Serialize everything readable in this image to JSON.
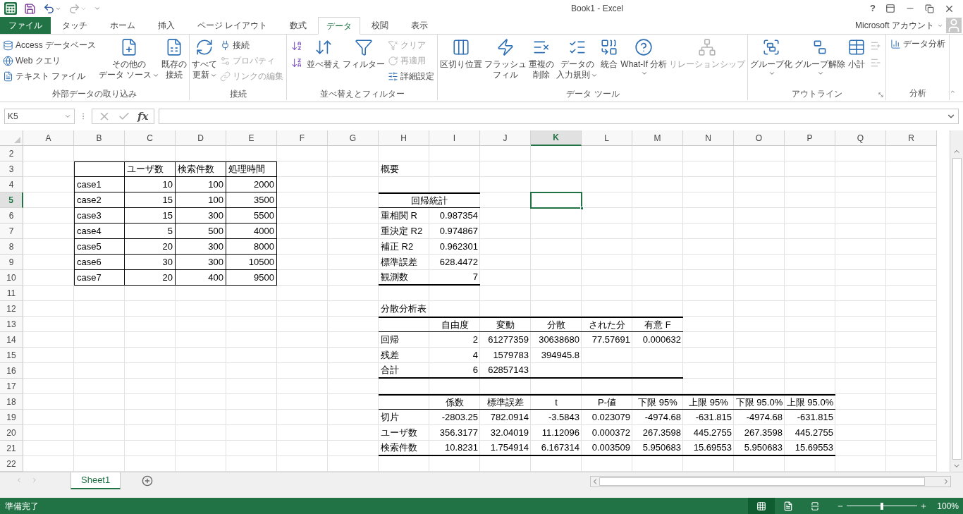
{
  "title_bar": {
    "title": "Book1 - Excel",
    "help": "?",
    "account": "Microsoft アカウント"
  },
  "ribbon_tabs": [
    {
      "label": "ファイル",
      "kind": "file",
      "selected": false
    },
    {
      "label": "タッチ",
      "kind": "tab",
      "selected": false
    },
    {
      "label": "ホーム",
      "kind": "tab",
      "selected": false
    },
    {
      "label": "挿入",
      "kind": "tab",
      "selected": false
    },
    {
      "label": "ページ レイアウト",
      "kind": "tab",
      "selected": false
    },
    {
      "label": "数式",
      "kind": "tab",
      "selected": false
    },
    {
      "label": "データ",
      "kind": "tab",
      "selected": true
    },
    {
      "label": "校閲",
      "kind": "tab",
      "selected": false
    },
    {
      "label": "表示",
      "kind": "tab",
      "selected": false
    }
  ],
  "ribbon_groups": [
    {
      "label": "外部データの取り込み",
      "columns": [
        [
          {
            "kind": "small",
            "label": "Access データベース",
            "disabled": false
          },
          {
            "kind": "small",
            "label": "Web クエリ",
            "disabled": false
          },
          {
            "kind": "small",
            "label": "テキスト ファイル",
            "disabled": false
          }
        ],
        [
          {
            "kind": "large",
            "lines": [
              "その他の",
              "データ ソース"
            ],
            "dropdown": true,
            "disabled": false
          }
        ],
        [
          {
            "kind": "large",
            "lines": [
              "既存の",
              "接続"
            ],
            "disabled": false
          }
        ]
      ]
    },
    {
      "label": "接続",
      "columns": [
        [
          {
            "kind": "large",
            "lines": [
              "すべて",
              "更新"
            ],
            "dropdown": true,
            "disabled": false
          }
        ],
        [
          {
            "kind": "small",
            "label": "接続",
            "disabled": false
          },
          {
            "kind": "small",
            "label": "プロパティ",
            "disabled": true
          },
          {
            "kind": "small",
            "label": "リンクの編集",
            "disabled": true
          }
        ]
      ]
    },
    {
      "label": "並べ替えとフィルター",
      "columns": [
        [
          {
            "kind": "icon",
            "disabled": false
          },
          {
            "kind": "icon",
            "disabled": false
          }
        ],
        [
          {
            "kind": "large",
            "lines": [
              "並べ替え"
            ],
            "disabled": false
          }
        ],
        [
          {
            "kind": "large",
            "lines": [
              "フィルター"
            ],
            "disabled": false
          }
        ],
        [
          {
            "kind": "small",
            "label": "クリア",
            "disabled": true
          },
          {
            "kind": "small",
            "label": "再適用",
            "disabled": true
          },
          {
            "kind": "small",
            "label": "詳細設定",
            "disabled": false
          }
        ]
      ]
    },
    {
      "label": "データ ツール",
      "columns": [
        [
          {
            "kind": "large",
            "lines": [
              "区切り位置"
            ],
            "disabled": false
          }
        ],
        [
          {
            "kind": "large",
            "lines": [
              "フラッシュ",
              "フィル"
            ],
            "disabled": false
          }
        ],
        [
          {
            "kind": "large",
            "lines": [
              "重複の",
              "削除"
            ],
            "disabled": false
          }
        ],
        [
          {
            "kind": "large",
            "lines": [
              "データの",
              "入力規則"
            ],
            "dropdown": true,
            "disabled": false
          }
        ],
        [
          {
            "kind": "large",
            "lines": [
              "統合"
            ],
            "disabled": false
          }
        ],
        [
          {
            "kind": "large",
            "lines": [
              "What-If 分析"
            ],
            "dropdown": true,
            "disabled": false
          }
        ],
        [
          {
            "kind": "large",
            "lines": [
              "リレーションシップ"
            ],
            "disabled": true
          }
        ]
      ]
    },
    {
      "label": "アウトライン",
      "launcher": true,
      "columns": [
        [
          {
            "kind": "large",
            "lines": [
              "グループ化"
            ],
            "dropdown": true,
            "disabled": false
          }
        ],
        [
          {
            "kind": "large",
            "lines": [
              "グループ解除"
            ],
            "dropdown": true,
            "disabled": false
          }
        ],
        [
          {
            "kind": "large",
            "lines": [
              "小計"
            ],
            "disabled": false
          }
        ],
        [
          {
            "kind": "icon",
            "disabled": true
          },
          {
            "kind": "icon",
            "disabled": true
          }
        ]
      ]
    },
    {
      "label": "分析",
      "columns": [
        [
          {
            "kind": "small",
            "label": "データ分析",
            "disabled": false
          }
        ]
      ]
    }
  ],
  "formula_bar": {
    "name_box": "K5",
    "function_label": "fx"
  },
  "grid": {
    "columns": [
      {
        "label": "A",
        "selected": false
      },
      {
        "label": "B",
        "selected": false
      },
      {
        "label": "C",
        "selected": false
      },
      {
        "label": "D",
        "selected": false
      },
      {
        "label": "E",
        "selected": false
      },
      {
        "label": "F",
        "selected": false
      },
      {
        "label": "G",
        "selected": false
      },
      {
        "label": "H",
        "selected": false
      },
      {
        "label": "I",
        "selected": false
      },
      {
        "label": "J",
        "selected": false
      },
      {
        "label": "K",
        "selected": true
      },
      {
        "label": "L",
        "selected": false
      },
      {
        "label": "M",
        "selected": false
      },
      {
        "label": "N",
        "selected": false
      },
      {
        "label": "O",
        "selected": false
      },
      {
        "label": "P",
        "selected": false
      },
      {
        "label": "Q",
        "selected": false
      },
      {
        "label": "R",
        "selected": false
      }
    ],
    "rows": [
      {
        "header": "2",
        "selected": false
      },
      {
        "header": "3",
        "selected": false,
        "cells": [
          null,
          null,
          {
            "text": "ユーザ数",
            "kind": "text"
          },
          {
            "text": "検索件数",
            "kind": "text"
          },
          {
            "text": "処理時間",
            "kind": "text"
          },
          null,
          null,
          {
            "text": "概要",
            "kind": "text"
          }
        ]
      },
      {
        "header": "4",
        "selected": false,
        "cells": [
          null,
          {
            "text": "case1",
            "kind": "text"
          },
          {
            "text": "10",
            "kind": "num"
          },
          {
            "text": "100",
            "kind": "num"
          },
          {
            "text": "2000",
            "kind": "num"
          }
        ]
      },
      {
        "header": "5",
        "selected": true,
        "cells": [
          null,
          {
            "text": "case2",
            "kind": "text"
          },
          {
            "text": "15",
            "kind": "num"
          },
          {
            "text": "100",
            "kind": "num"
          },
          {
            "text": "3500",
            "kind": "num"
          },
          null,
          null,
          {
            "text": "回帰統計",
            "kind": "merged"
          }
        ]
      },
      {
        "header": "6",
        "selected": false,
        "cells": [
          null,
          {
            "text": "case3",
            "kind": "text"
          },
          {
            "text": "15",
            "kind": "num"
          },
          {
            "text": "300",
            "kind": "num"
          },
          {
            "text": "5500",
            "kind": "num"
          },
          null,
          null,
          {
            "text": "重相関 R",
            "kind": "text"
          },
          {
            "text": "0.987354",
            "kind": "num"
          }
        ]
      },
      {
        "header": "7",
        "selected": false,
        "cells": [
          null,
          {
            "text": "case4",
            "kind": "text"
          },
          {
            "text": "5",
            "kind": "num"
          },
          {
            "text": "500",
            "kind": "num"
          },
          {
            "text": "4000",
            "kind": "num"
          },
          null,
          null,
          {
            "text": "重決定 R2",
            "kind": "text"
          },
          {
            "text": "0.974867",
            "kind": "num"
          }
        ]
      },
      {
        "header": "8",
        "selected": false,
        "cells": [
          null,
          {
            "text": "case5",
            "kind": "text"
          },
          {
            "text": "20",
            "kind": "num"
          },
          {
            "text": "300",
            "kind": "num"
          },
          {
            "text": "8000",
            "kind": "num"
          },
          null,
          null,
          {
            "text": "補正 R2",
            "kind": "text"
          },
          {
            "text": "0.962301",
            "kind": "num"
          }
        ]
      },
      {
        "header": "9",
        "selected": false,
        "cells": [
          null,
          {
            "text": "case6",
            "kind": "text"
          },
          {
            "text": "30",
            "kind": "num"
          },
          {
            "text": "300",
            "kind": "num"
          },
          {
            "text": "10500",
            "kind": "num"
          },
          null,
          null,
          {
            "text": "標準誤差",
            "kind": "text"
          },
          {
            "text": "628.4472",
            "kind": "num"
          }
        ]
      },
      {
        "header": "10",
        "selected": false,
        "cells": [
          null,
          {
            "text": "case7",
            "kind": "text"
          },
          {
            "text": "20",
            "kind": "num"
          },
          {
            "text": "400",
            "kind": "num"
          },
          {
            "text": "9500",
            "kind": "num"
          },
          null,
          null,
          {
            "text": "観測数",
            "kind": "text"
          },
          {
            "text": "7",
            "kind": "num"
          }
        ]
      },
      {
        "header": "11",
        "selected": false
      },
      {
        "header": "12",
        "selected": false,
        "cells": [
          null,
          null,
          null,
          null,
          null,
          null,
          null,
          {
            "text": "分散分析表",
            "kind": "text"
          }
        ]
      },
      {
        "header": "13",
        "selected": false,
        "cells": [
          null,
          null,
          null,
          null,
          null,
          null,
          null,
          null,
          {
            "text": "自由度",
            "kind": "center"
          },
          {
            "text": "変動",
            "kind": "center"
          },
          {
            "text": "分散",
            "kind": "center"
          },
          {
            "text": "された分",
            "kind": "center"
          },
          {
            "text": "有意 F",
            "kind": "center"
          }
        ]
      },
      {
        "header": "14",
        "selected": false,
        "cells": [
          null,
          null,
          null,
          null,
          null,
          null,
          null,
          {
            "text": "回帰",
            "kind": "text"
          },
          {
            "text": "2",
            "kind": "num"
          },
          {
            "text": "61277359",
            "kind": "num"
          },
          {
            "text": "30638680",
            "kind": "num"
          },
          {
            "text": "77.57691",
            "kind": "num"
          },
          {
            "text": "0.000632",
            "kind": "num"
          }
        ]
      },
      {
        "header": "15",
        "selected": false,
        "cells": [
          null,
          null,
          null,
          null,
          null,
          null,
          null,
          {
            "text": "残差",
            "kind": "text"
          },
          {
            "text": "4",
            "kind": "num"
          },
          {
            "text": "1579783",
            "kind": "num"
          },
          {
            "text": "394945.8",
            "kind": "num"
          }
        ]
      },
      {
        "header": "16",
        "selected": false,
        "cells": [
          null,
          null,
          null,
          null,
          null,
          null,
          null,
          {
            "text": "合計",
            "kind": "text"
          },
          {
            "text": "6",
            "kind": "num"
          },
          {
            "text": "62857143",
            "kind": "num"
          }
        ]
      },
      {
        "header": "17",
        "selected": false
      },
      {
        "header": "18",
        "selected": false,
        "cells": [
          null,
          null,
          null,
          null,
          null,
          null,
          null,
          null,
          {
            "text": "係数",
            "kind": "center"
          },
          {
            "text": "標準誤差",
            "kind": "center"
          },
          {
            "text": "t",
            "kind": "center"
          },
          {
            "text": "P-値",
            "kind": "center"
          },
          {
            "text": "下限 95%",
            "kind": "center"
          },
          {
            "text": "上限 95%",
            "kind": "center"
          },
          {
            "text": "下限 95.0%",
            "kind": "center"
          },
          {
            "text": "上限 95.0%",
            "kind": "center"
          }
        ]
      },
      {
        "header": "19",
        "selected": false,
        "cells": [
          null,
          null,
          null,
          null,
          null,
          null,
          null,
          {
            "text": "切片",
            "kind": "text"
          },
          {
            "text": "-2803.25",
            "kind": "num"
          },
          {
            "text": "782.0914",
            "kind": "num"
          },
          {
            "text": "-3.5843",
            "kind": "num"
          },
          {
            "text": "0.023079",
            "kind": "num"
          },
          {
            "text": "-4974.68",
            "kind": "num"
          },
          {
            "text": "-631.815",
            "kind": "num"
          },
          {
            "text": "-4974.68",
            "kind": "num"
          },
          {
            "text": "-631.815",
            "kind": "num"
          }
        ]
      },
      {
        "header": "20",
        "selected": false,
        "cells": [
          null,
          null,
          null,
          null,
          null,
          null,
          null,
          {
            "text": "ユーザ数",
            "kind": "text"
          },
          {
            "text": "356.3177",
            "kind": "num"
          },
          {
            "text": "32.04019",
            "kind": "num"
          },
          {
            "text": "11.12096",
            "kind": "num"
          },
          {
            "text": "0.000372",
            "kind": "num"
          },
          {
            "text": "267.3598",
            "kind": "num"
          },
          {
            "text": "445.2755",
            "kind": "num"
          },
          {
            "text": "267.3598",
            "kind": "num"
          },
          {
            "text": "445.2755",
            "kind": "num"
          }
        ]
      },
      {
        "header": "21",
        "selected": false,
        "cells": [
          null,
          null,
          null,
          null,
          null,
          null,
          null,
          {
            "text": "検索件数",
            "kind": "text"
          },
          {
            "text": "10.8231",
            "kind": "num"
          },
          {
            "text": "1.754914",
            "kind": "num"
          },
          {
            "text": "6.167314",
            "kind": "num"
          },
          {
            "text": "0.003509",
            "kind": "num"
          },
          {
            "text": "5.950683",
            "kind": "num"
          },
          {
            "text": "15.69553",
            "kind": "num"
          },
          {
            "text": "5.950683",
            "kind": "num"
          },
          {
            "text": "15.69553",
            "kind": "num"
          }
        ]
      },
      {
        "header": "22",
        "selected": false
      }
    ]
  },
  "sheet_tabs": [
    {
      "label": "Sheet1",
      "selected": true
    }
  ],
  "status_bar": {
    "status": "準備完了",
    "views": [
      {
        "selected": true
      },
      {
        "selected": false
      },
      {
        "selected": false
      }
    ],
    "zoom": {
      "level": 0.5,
      "reading": "100%"
    }
  }
}
